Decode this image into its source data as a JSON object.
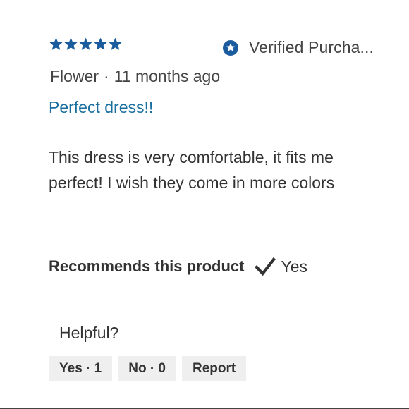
{
  "review": {
    "rating": 5,
    "rating_max": 5,
    "verified_label": "Verified Purcha...",
    "author": "Flower",
    "separator": "·",
    "date": "11 months ago",
    "title": "Perfect dress!!",
    "body": "This dress is very comfortable, it fits me perfect! I wish they come in more colors",
    "recommends_label": "Recommends this product",
    "recommends_value": "Yes"
  },
  "feedback": {
    "prompt": "Helpful?",
    "yes_label": "Yes · 1",
    "no_label": "No · 0",
    "report_label": "Report"
  },
  "colors": {
    "star": "#1a5c9e",
    "verified_icon": "#1a5c9e",
    "title": "#1a6fa0",
    "text": "#333333",
    "button_bg": "#efefef"
  },
  "icons": {
    "rating": "star-icon",
    "verified": "verified-badge-icon",
    "recommend": "checkmark-icon"
  }
}
